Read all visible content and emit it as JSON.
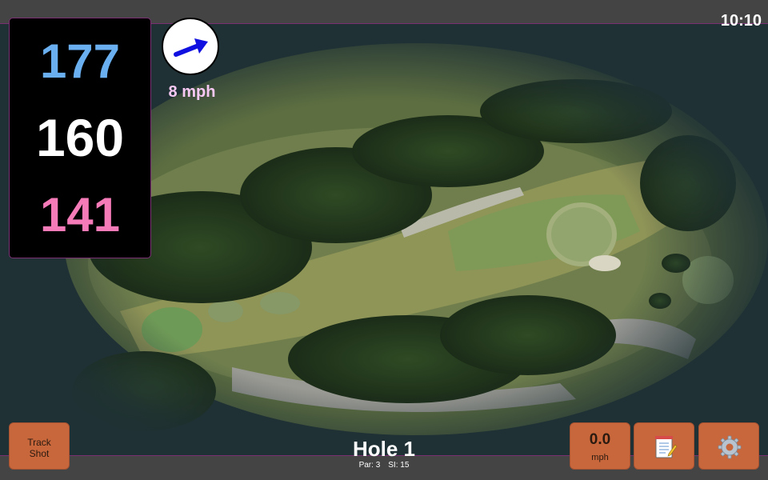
{
  "status": {
    "time": "10:10"
  },
  "distances": {
    "back": "177",
    "middle": "160",
    "front": "141"
  },
  "wind": {
    "speed": "8 mph",
    "icon": "wind-direction-arrow-icon",
    "arrow_color": "#1010e0"
  },
  "buttons": {
    "track_shot": {
      "line1": "Track",
      "line2": "Shot"
    },
    "speed": {
      "value": "0.0",
      "unit": "mph"
    },
    "notes": {
      "icon": "notepad-icon"
    },
    "settings": {
      "icon": "gear-icon"
    }
  },
  "hole": {
    "title": "Hole 1",
    "par": "Par: 3",
    "si": "SI: 15"
  },
  "colors": {
    "back_distance": "#6ab0f0",
    "middle_distance": "#ffffff",
    "front_distance": "#f47ab8",
    "button": "#c9673c",
    "accent_border": "#7a2f73"
  }
}
